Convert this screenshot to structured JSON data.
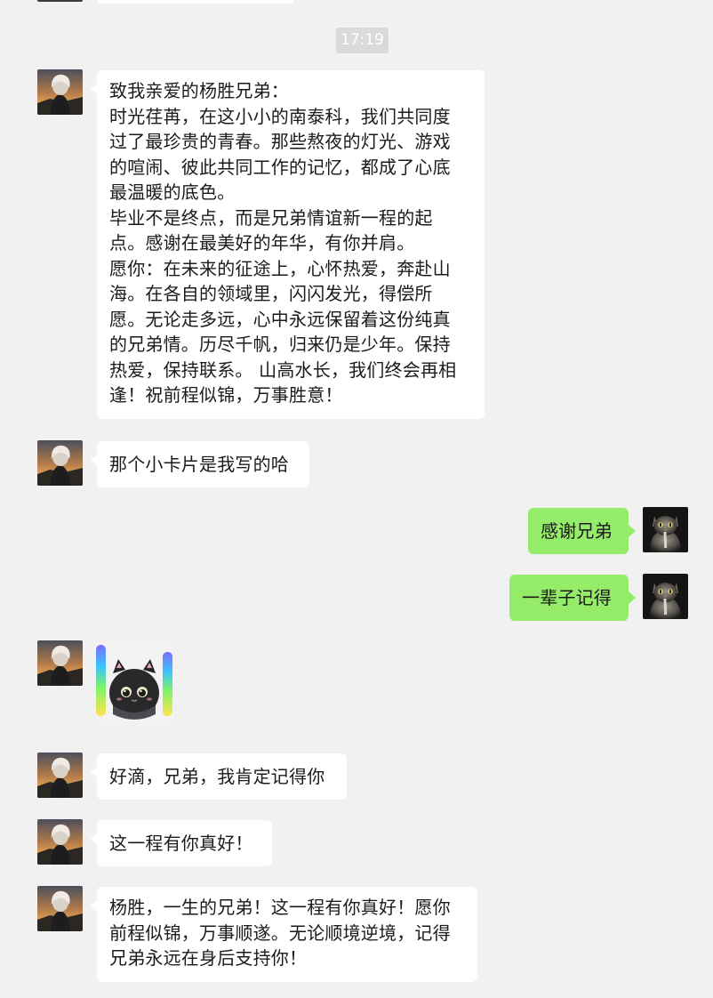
{
  "timestamp": "17:19",
  "colors": {
    "background": "#f1f1f1",
    "incoming": "#ffffff",
    "outgoing": "#95ec69",
    "time_badge": "#dadada"
  },
  "messages": [
    {
      "from": "friend",
      "lines": [
        "致我亲爱的杨胜兄弟：",
        "时光荏苒，在这小小的南泰科，我们共同度",
        "过了最珍贵的青春。那些熬夜的灯光、游戏",
        "的喧闹、彼此共同工作的记忆，都成了心底",
        "最温暖的底色。",
        "毕业不是终点，而是兄弟情谊新一程的起",
        "点。感谢在最美好的年华，有你并肩。",
        "愿你：在未来的征途上，心怀热爱，奔赴山",
        "海。在各自的领域里，闪闪发光，得偿所",
        "愿。无论走多远，心中永远保留着这份纯真",
        "的兄弟情。历尽千帆，归来仍是少年。保持",
        "热爱，保持联系。 山高水长，我们终会再相",
        "逢！祝前程似锦，万事胜意！"
      ]
    },
    {
      "from": "friend",
      "text": "那个小卡片是我写的哈"
    },
    {
      "from": "me",
      "text": "感谢兄弟"
    },
    {
      "from": "me",
      "text": "一辈子记得"
    },
    {
      "from": "friend",
      "sticker": "black-cat-sticker"
    },
    {
      "from": "friend",
      "text": "好滴，兄弟，我肯定记得你"
    },
    {
      "from": "friend",
      "text": "这一程有你真好！"
    },
    {
      "from": "friend",
      "lines": [
        "杨胜，一生的兄弟！这一程有你真好！愿你",
        "前程似锦，万事顺遂。无论顺境逆境，记得",
        "兄弟永远在身后支持你！"
      ]
    }
  ]
}
